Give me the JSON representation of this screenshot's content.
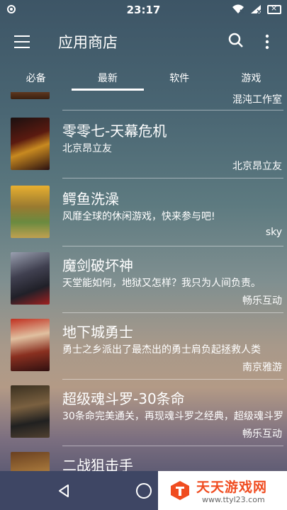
{
  "status": {
    "time": "23:17"
  },
  "appbar": {
    "title": "应用商店"
  },
  "tabs": [
    {
      "label": "必备"
    },
    {
      "label": "最新"
    },
    {
      "label": "软件"
    },
    {
      "label": "游戏"
    }
  ],
  "active_tab": "最新",
  "list": {
    "partial_top_developer": "混沌工作室",
    "items": [
      {
        "name": "零零七-天幕危机",
        "description": "北京昂立友",
        "developer": "北京昂立友"
      },
      {
        "name": "鳄鱼洗澡",
        "description": "风靡全球的休闲游戏，快来参与吧!",
        "developer": "sky"
      },
      {
        "name": "魔剑破坏神",
        "description": "天堂能如何，地狱又怎样？我只为人间负责。",
        "developer": "畅乐互动"
      },
      {
        "name": "地下城勇士",
        "description": "勇士之乡派出了最杰出的勇士肩负起拯救人类",
        "developer": "南京雅游"
      },
      {
        "name": "超级魂斗罗-30条命",
        "description": "30条命完美通关，再现魂斗罗之经典，超级魂斗罗",
        "developer": "畅乐互动"
      },
      {
        "name": "二战狙击手",
        "description": "",
        "developer": ""
      }
    ]
  },
  "watermark": {
    "title": "天天游戏网",
    "url": "www.ttyl23.com"
  }
}
